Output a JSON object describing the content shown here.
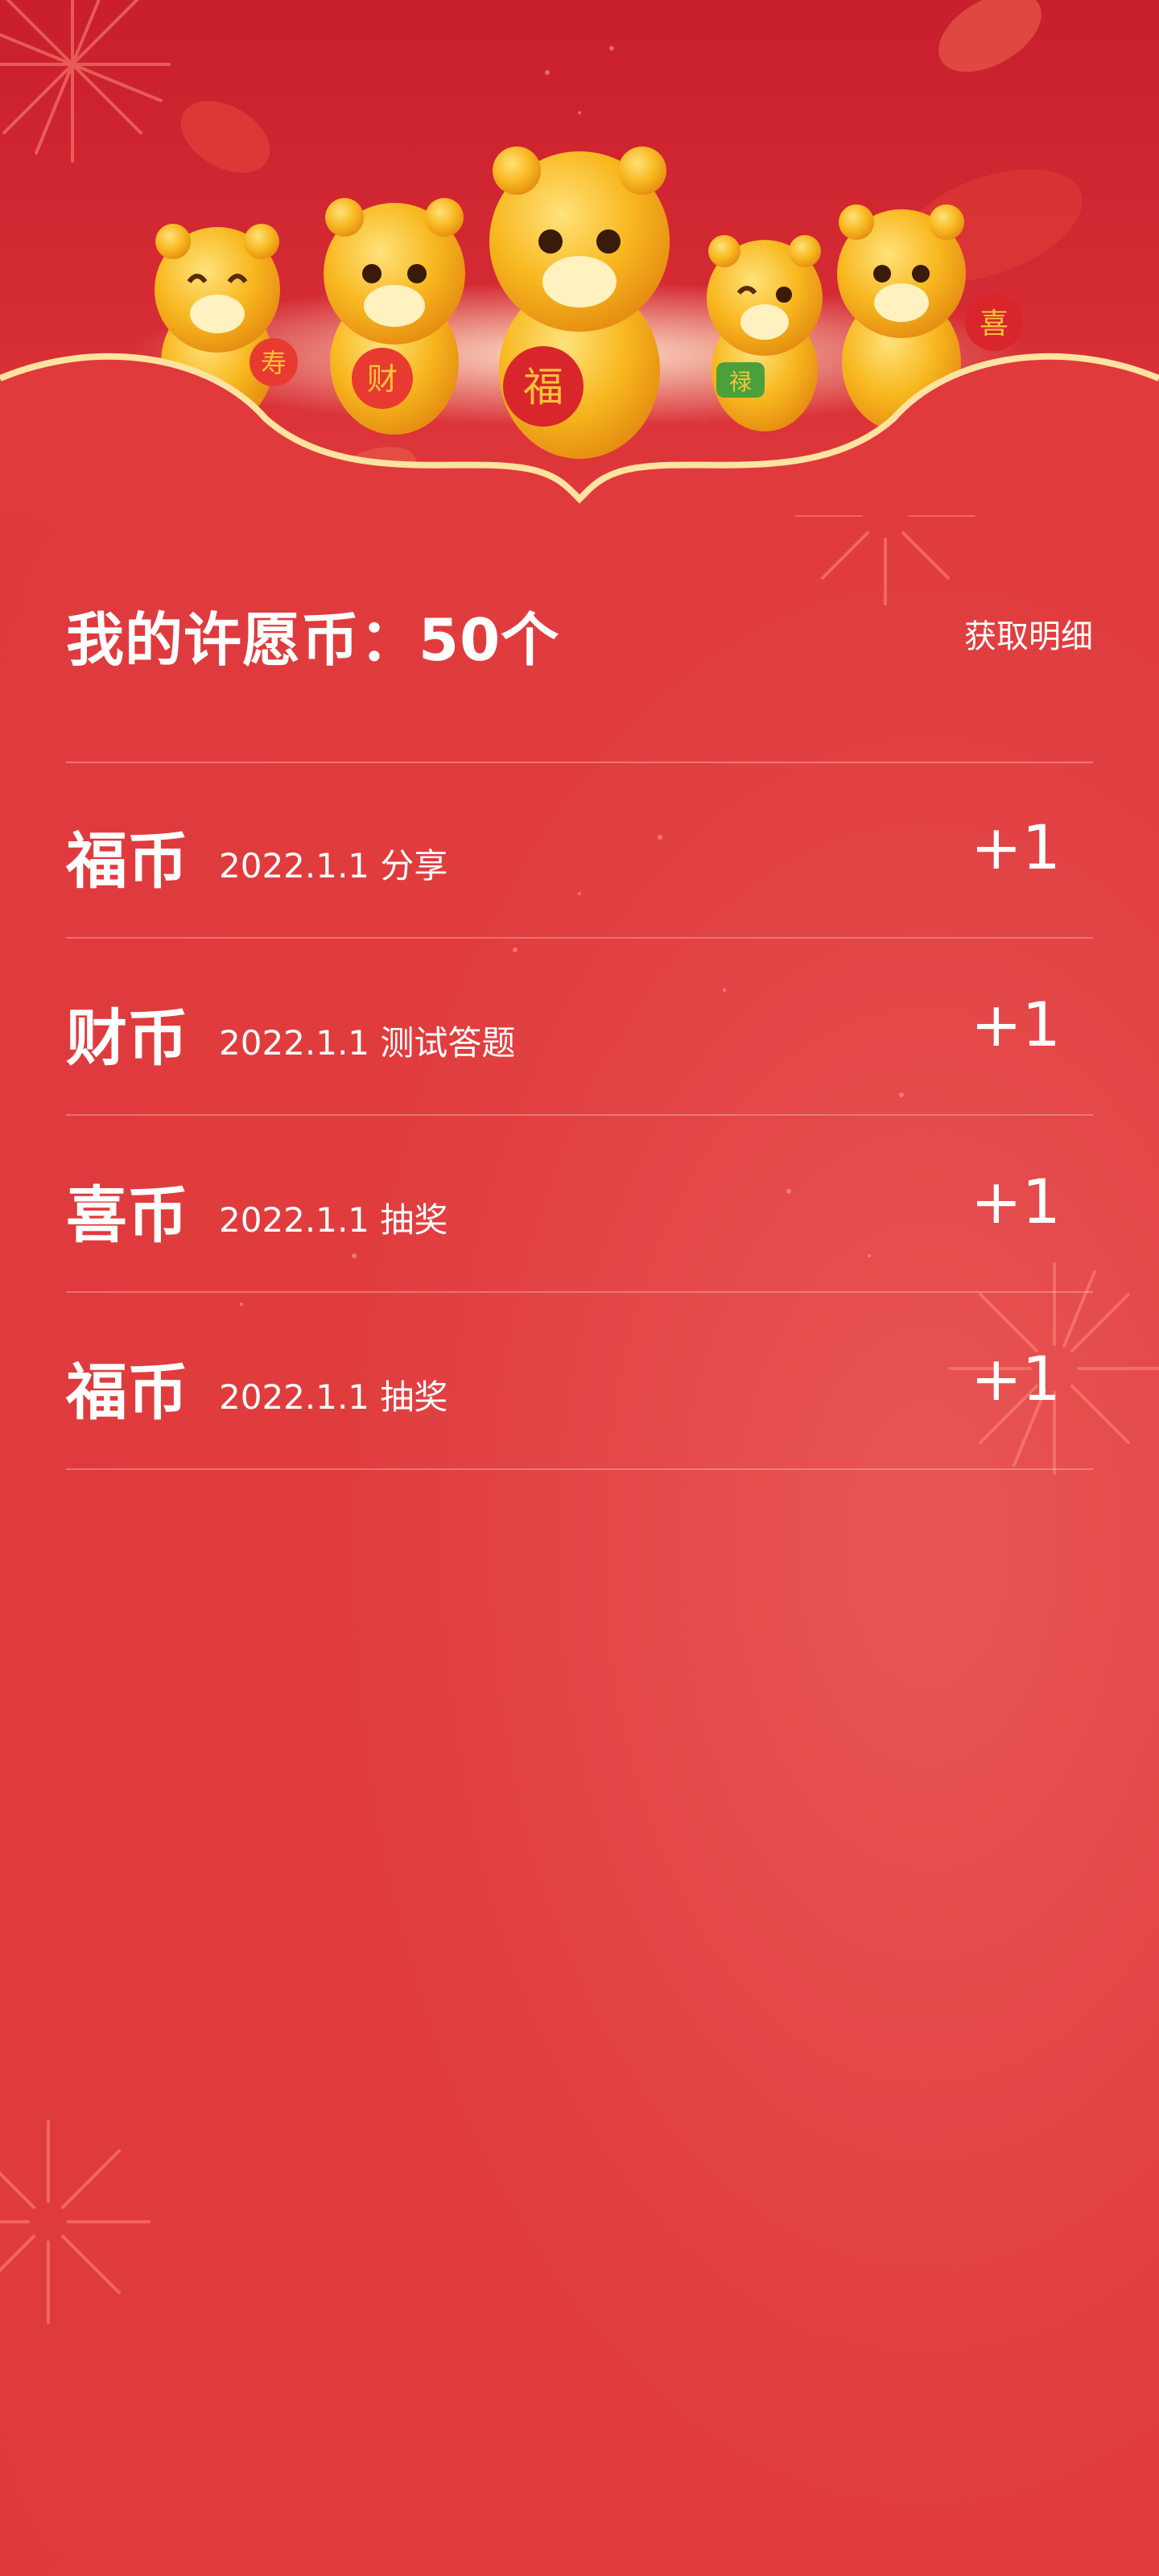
{
  "header": {
    "title": "我的许愿币：50个",
    "detail_link": "获取明细"
  },
  "records": [
    {
      "coin": "福币",
      "date": "2022.1.1",
      "source": "分享",
      "amount": "+1"
    },
    {
      "coin": "财币",
      "date": "2022.1.1",
      "source": "测试答题",
      "amount": "+1"
    },
    {
      "coin": "喜币",
      "date": "2022.1.1",
      "source": "抽奖",
      "amount": "+1"
    },
    {
      "coin": "福币",
      "date": "2022.1.1",
      "source": "抽奖",
      "amount": "+1"
    }
  ],
  "banner": {
    "tiger_badges": [
      "寿",
      "财",
      "福",
      "禄",
      "喜"
    ]
  },
  "colors": {
    "background": "#e03c3e",
    "banner_red": "#c91f2d",
    "gold": "#f6b51a",
    "text": "#ffffff"
  }
}
